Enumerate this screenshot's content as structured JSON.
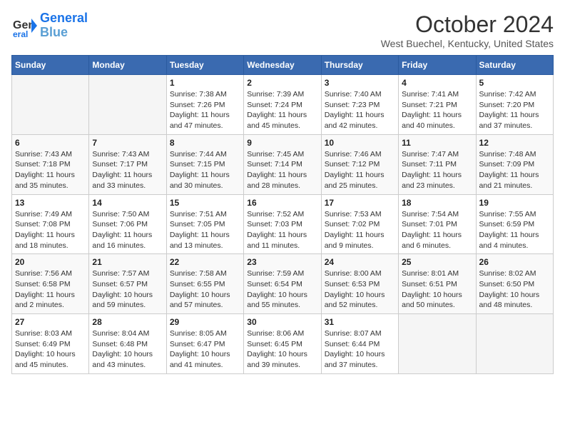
{
  "header": {
    "logo_line1": "General",
    "logo_line2": "Blue",
    "month": "October 2024",
    "location": "West Buechel, Kentucky, United States"
  },
  "weekdays": [
    "Sunday",
    "Monday",
    "Tuesday",
    "Wednesday",
    "Thursday",
    "Friday",
    "Saturday"
  ],
  "weeks": [
    [
      {
        "day": "",
        "info": ""
      },
      {
        "day": "",
        "info": ""
      },
      {
        "day": "1",
        "info": "Sunrise: 7:38 AM\nSunset: 7:26 PM\nDaylight: 11 hours and 47 minutes."
      },
      {
        "day": "2",
        "info": "Sunrise: 7:39 AM\nSunset: 7:24 PM\nDaylight: 11 hours and 45 minutes."
      },
      {
        "day": "3",
        "info": "Sunrise: 7:40 AM\nSunset: 7:23 PM\nDaylight: 11 hours and 42 minutes."
      },
      {
        "day": "4",
        "info": "Sunrise: 7:41 AM\nSunset: 7:21 PM\nDaylight: 11 hours and 40 minutes."
      },
      {
        "day": "5",
        "info": "Sunrise: 7:42 AM\nSunset: 7:20 PM\nDaylight: 11 hours and 37 minutes."
      }
    ],
    [
      {
        "day": "6",
        "info": "Sunrise: 7:43 AM\nSunset: 7:18 PM\nDaylight: 11 hours and 35 minutes."
      },
      {
        "day": "7",
        "info": "Sunrise: 7:43 AM\nSunset: 7:17 PM\nDaylight: 11 hours and 33 minutes."
      },
      {
        "day": "8",
        "info": "Sunrise: 7:44 AM\nSunset: 7:15 PM\nDaylight: 11 hours and 30 minutes."
      },
      {
        "day": "9",
        "info": "Sunrise: 7:45 AM\nSunset: 7:14 PM\nDaylight: 11 hours and 28 minutes."
      },
      {
        "day": "10",
        "info": "Sunrise: 7:46 AM\nSunset: 7:12 PM\nDaylight: 11 hours and 25 minutes."
      },
      {
        "day": "11",
        "info": "Sunrise: 7:47 AM\nSunset: 7:11 PM\nDaylight: 11 hours and 23 minutes."
      },
      {
        "day": "12",
        "info": "Sunrise: 7:48 AM\nSunset: 7:09 PM\nDaylight: 11 hours and 21 minutes."
      }
    ],
    [
      {
        "day": "13",
        "info": "Sunrise: 7:49 AM\nSunset: 7:08 PM\nDaylight: 11 hours and 18 minutes."
      },
      {
        "day": "14",
        "info": "Sunrise: 7:50 AM\nSunset: 7:06 PM\nDaylight: 11 hours and 16 minutes."
      },
      {
        "day": "15",
        "info": "Sunrise: 7:51 AM\nSunset: 7:05 PM\nDaylight: 11 hours and 13 minutes."
      },
      {
        "day": "16",
        "info": "Sunrise: 7:52 AM\nSunset: 7:03 PM\nDaylight: 11 hours and 11 minutes."
      },
      {
        "day": "17",
        "info": "Sunrise: 7:53 AM\nSunset: 7:02 PM\nDaylight: 11 hours and 9 minutes."
      },
      {
        "day": "18",
        "info": "Sunrise: 7:54 AM\nSunset: 7:01 PM\nDaylight: 11 hours and 6 minutes."
      },
      {
        "day": "19",
        "info": "Sunrise: 7:55 AM\nSunset: 6:59 PM\nDaylight: 11 hours and 4 minutes."
      }
    ],
    [
      {
        "day": "20",
        "info": "Sunrise: 7:56 AM\nSunset: 6:58 PM\nDaylight: 11 hours and 2 minutes."
      },
      {
        "day": "21",
        "info": "Sunrise: 7:57 AM\nSunset: 6:57 PM\nDaylight: 10 hours and 59 minutes."
      },
      {
        "day": "22",
        "info": "Sunrise: 7:58 AM\nSunset: 6:55 PM\nDaylight: 10 hours and 57 minutes."
      },
      {
        "day": "23",
        "info": "Sunrise: 7:59 AM\nSunset: 6:54 PM\nDaylight: 10 hours and 55 minutes."
      },
      {
        "day": "24",
        "info": "Sunrise: 8:00 AM\nSunset: 6:53 PM\nDaylight: 10 hours and 52 minutes."
      },
      {
        "day": "25",
        "info": "Sunrise: 8:01 AM\nSunset: 6:51 PM\nDaylight: 10 hours and 50 minutes."
      },
      {
        "day": "26",
        "info": "Sunrise: 8:02 AM\nSunset: 6:50 PM\nDaylight: 10 hours and 48 minutes."
      }
    ],
    [
      {
        "day": "27",
        "info": "Sunrise: 8:03 AM\nSunset: 6:49 PM\nDaylight: 10 hours and 45 minutes."
      },
      {
        "day": "28",
        "info": "Sunrise: 8:04 AM\nSunset: 6:48 PM\nDaylight: 10 hours and 43 minutes."
      },
      {
        "day": "29",
        "info": "Sunrise: 8:05 AM\nSunset: 6:47 PM\nDaylight: 10 hours and 41 minutes."
      },
      {
        "day": "30",
        "info": "Sunrise: 8:06 AM\nSunset: 6:45 PM\nDaylight: 10 hours and 39 minutes."
      },
      {
        "day": "31",
        "info": "Sunrise: 8:07 AM\nSunset: 6:44 PM\nDaylight: 10 hours and 37 minutes."
      },
      {
        "day": "",
        "info": ""
      },
      {
        "day": "",
        "info": ""
      }
    ]
  ]
}
